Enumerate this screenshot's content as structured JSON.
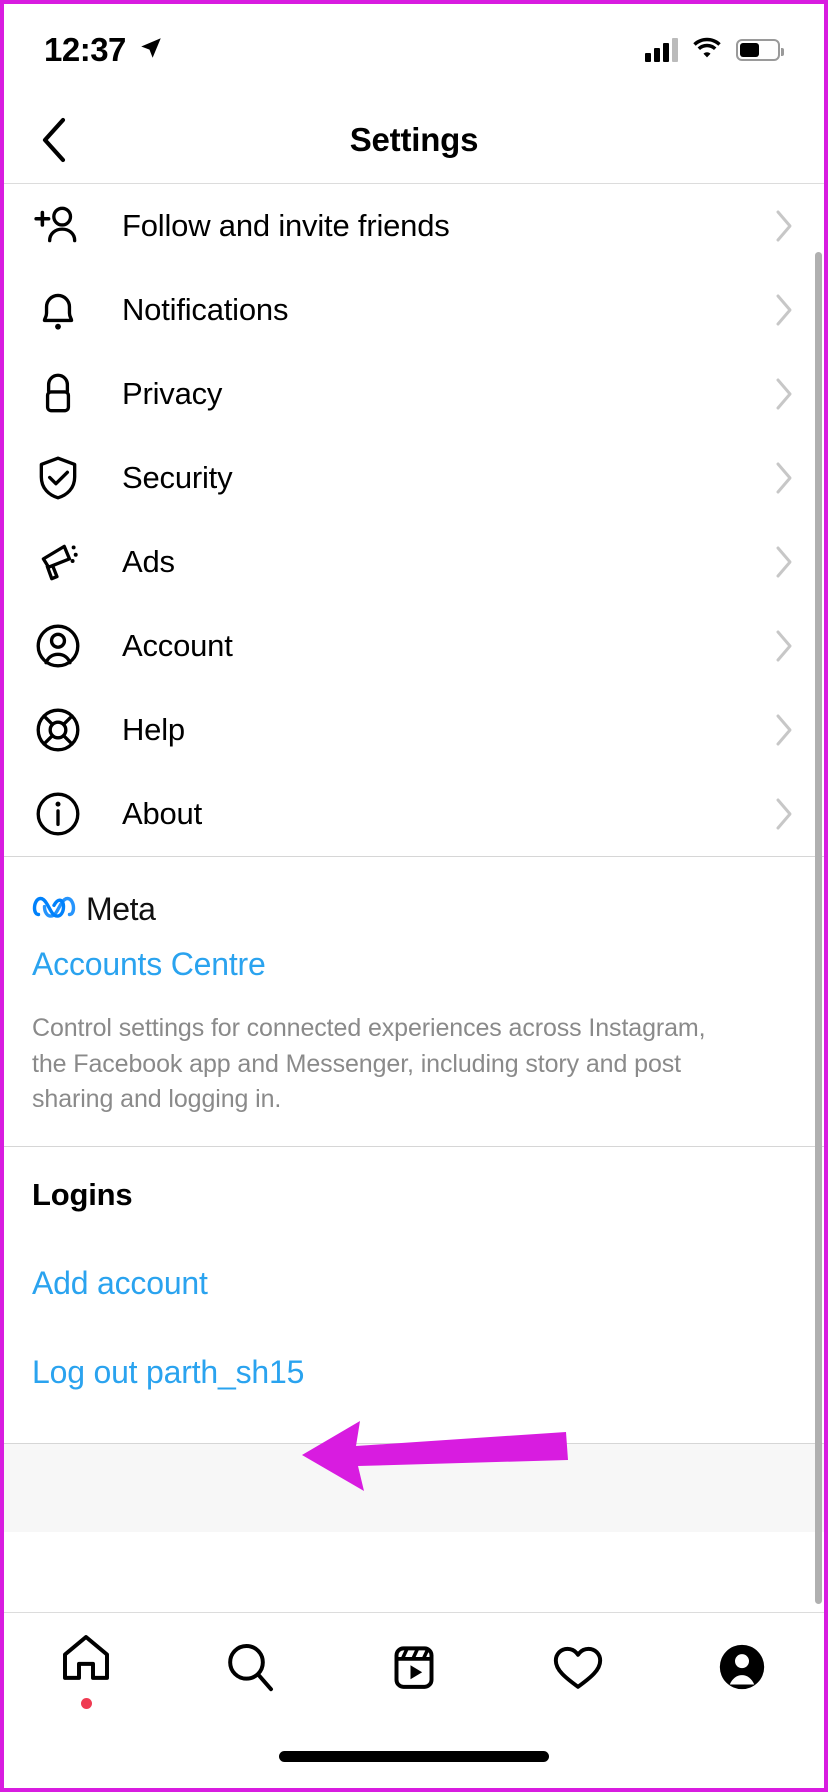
{
  "status_bar": {
    "time": "12:37",
    "location_icon": "location-arrow-icon",
    "signal_icon": "cellular-signal-icon",
    "wifi_icon": "wifi-icon",
    "battery_icon": "battery-icon",
    "battery_level_pct": 52
  },
  "header": {
    "title": "Settings",
    "back_icon": "chevron-left-icon"
  },
  "settings_list": [
    {
      "label": "Follow and invite friends",
      "icon": "person-plus-icon"
    },
    {
      "label": "Notifications",
      "icon": "bell-icon"
    },
    {
      "label": "Privacy",
      "icon": "lock-icon"
    },
    {
      "label": "Security",
      "icon": "shield-check-icon"
    },
    {
      "label": "Ads",
      "icon": "megaphone-icon"
    },
    {
      "label": "Account",
      "icon": "person-circle-icon"
    },
    {
      "label": "Help",
      "icon": "lifebuoy-icon"
    },
    {
      "label": "About",
      "icon": "info-circle-icon"
    }
  ],
  "meta_section": {
    "brand_icon": "meta-infinity-logo",
    "brand_name": "Meta",
    "accounts_centre_link": "Accounts Centre",
    "description": "Control settings for connected experiences across Instagram, the Facebook app and Messenger, including story and post sharing and logging in."
  },
  "logins_section": {
    "title": "Logins",
    "add_account_link": "Add account",
    "log_out_link": "Log out parth_sh15"
  },
  "annotation": {
    "type": "arrow",
    "color": "#d81ce0",
    "points_to": "Log out parth_sh15",
    "direction": "left"
  },
  "tab_bar": [
    {
      "name": "home",
      "icon": "home-icon",
      "badge": true
    },
    {
      "name": "search",
      "icon": "search-icon",
      "badge": false
    },
    {
      "name": "reels",
      "icon": "reels-icon",
      "badge": false
    },
    {
      "name": "activity",
      "icon": "heart-icon",
      "badge": false
    },
    {
      "name": "profile",
      "icon": "profile-avatar-icon",
      "badge": false
    }
  ],
  "colors": {
    "link_blue": "#2aa3ef",
    "meta_blue": "#0081fb",
    "annotation_magenta": "#d81ce0",
    "badge_red": "#ef3b52",
    "chevron_gray": "#c7c7c7",
    "muted_text": "#8a8a8a"
  }
}
